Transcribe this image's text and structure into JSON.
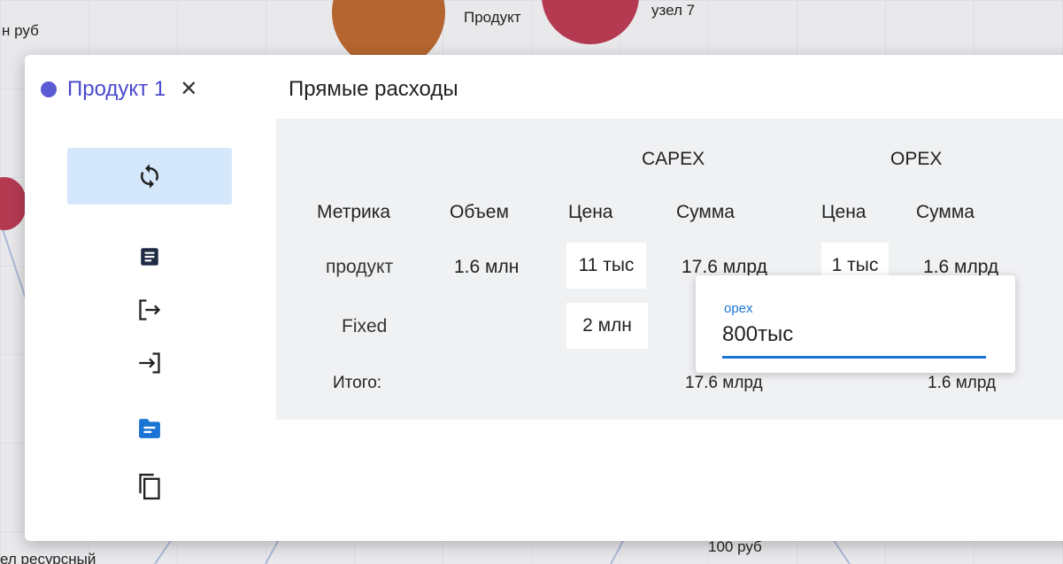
{
  "background": {
    "texts": [
      "н руб",
      "Продукт",
      "узел 7",
      "ел ресурсный",
      "100 руб"
    ]
  },
  "colors": {
    "accent": "#1a74d3",
    "product_dot": "#5b5bd6",
    "product_title": "#4a49cf",
    "refresh_bg": "#d5e7fb",
    "node_orange": "#b5652f",
    "node_red": "#b43a52"
  },
  "modal": {
    "product_title": "Продукт 1",
    "close_icon": "close-icon",
    "section_title": "Прямые расходы"
  },
  "sidebar": {
    "items": [
      {
        "icon": "refresh-icon"
      },
      {
        "icon": "document-icon"
      },
      {
        "icon": "logout-icon"
      },
      {
        "icon": "login-icon"
      },
      {
        "icon": "folder-icon"
      },
      {
        "icon": "copy-icon"
      }
    ]
  },
  "table": {
    "group_headers": [
      "CAPEX",
      "OPEX"
    ],
    "columns": [
      "Метрика",
      "Объем",
      "Цена",
      "Сумма",
      "Цена",
      "Сумма"
    ],
    "rows": [
      {
        "metric": "продукт",
        "volume": "1.6 млн",
        "capex_price": "11 тыс",
        "capex_sum": "17.6 млрд",
        "opex_price": "1 тыс",
        "opex_sum": "1.6 млрд"
      },
      {
        "metric": "Fixed",
        "volume": "",
        "capex_price": "2 млн",
        "capex_sum": "",
        "opex_price": "",
        "opex_sum": ""
      }
    ],
    "total": {
      "label": "Итого:",
      "capex_sum": "17.6 млрд",
      "opex_sum": "1.6 млрд"
    }
  },
  "popup": {
    "label": "opex",
    "value": "800тыс"
  }
}
